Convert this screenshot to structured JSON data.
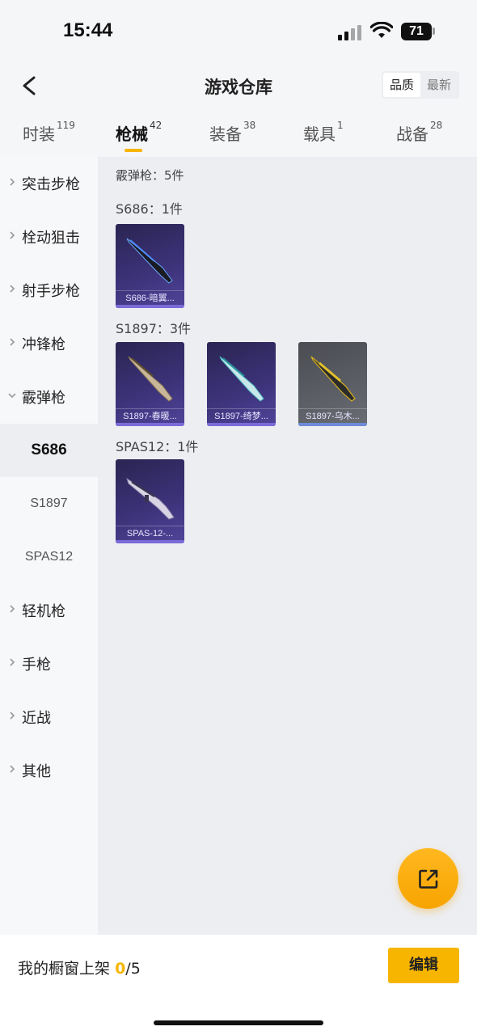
{
  "status_bar": {
    "time": "15:44",
    "battery": "71"
  },
  "header": {
    "title": "游戏仓库",
    "sort_options": [
      {
        "label": "品质",
        "active": true
      },
      {
        "label": "最新",
        "active": false
      }
    ]
  },
  "tabs": [
    {
      "label": "时装",
      "count": "119",
      "active": false
    },
    {
      "label": "枪械",
      "count": "42",
      "active": true
    },
    {
      "label": "装备",
      "count": "38",
      "active": false
    },
    {
      "label": "载具",
      "count": "1",
      "active": false
    },
    {
      "label": "战备",
      "count": "28",
      "active": false
    }
  ],
  "sidebar": {
    "categories": [
      {
        "label": "突击步枪",
        "expanded": false
      },
      {
        "label": "栓动狙击",
        "expanded": false
      },
      {
        "label": "射手步枪",
        "expanded": false
      },
      {
        "label": "冲锋枪",
        "expanded": false
      },
      {
        "label": "霰弹枪",
        "expanded": true
      }
    ],
    "subitems": [
      {
        "label": "S686",
        "active": true
      },
      {
        "label": "S1897",
        "active": false
      },
      {
        "label": "SPAS12",
        "active": false
      }
    ],
    "categories_after": [
      {
        "label": "轻机枪"
      },
      {
        "label": "手枪"
      },
      {
        "label": "近战"
      },
      {
        "label": "其他"
      }
    ]
  },
  "content": {
    "category_summary": "霰弹枪：5件",
    "groups": [
      {
        "title": "S686：1件",
        "items": [
          {
            "name": "S686-暗翼..."
          }
        ]
      },
      {
        "title": "S1897：3件",
        "items": [
          {
            "name": "S1897-春暖..."
          },
          {
            "name": "S1897-绮梦..."
          },
          {
            "name": "S1897-乌木..."
          }
        ]
      },
      {
        "title": "SPAS12：1件",
        "items": [
          {
            "name": "SPAS-12-..."
          }
        ]
      }
    ]
  },
  "bottom_bar": {
    "shelf_label": "我的橱窗上架",
    "shelf_count": "0",
    "shelf_total": "/5",
    "edit_label": "编辑"
  },
  "colors": {
    "accent": "#f7b500",
    "card_purple": "#3b3278"
  }
}
